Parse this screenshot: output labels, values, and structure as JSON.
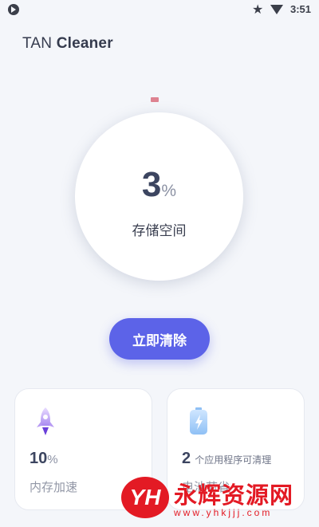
{
  "status_bar": {
    "time": "3:51",
    "icons": [
      "app-notification-icon",
      "star-icon",
      "wifi-icon"
    ]
  },
  "app": {
    "title_light": "TAN",
    "title_bold": "Cleaner"
  },
  "storage": {
    "value": "3",
    "unit": "%",
    "label": "存储空间"
  },
  "actions": {
    "clean_now": "立即清除"
  },
  "cards": {
    "memory": {
      "icon": "rocket-icon",
      "value": "10",
      "unit": "%",
      "label": "内存加速"
    },
    "apps": {
      "icon": "battery-icon",
      "value": "2",
      "suffix": "个应用程序可清理",
      "label": "电池节省"
    }
  },
  "watermark": {
    "badge": "YH",
    "text": "永辉资源网",
    "url": "www.yhkjjj.com"
  },
  "colors": {
    "accent": "#5c63e8",
    "background": "#f4f6fa",
    "text_primary": "#3c4560",
    "gauge_tick": "#de8291",
    "watermark": "#e31a24"
  }
}
